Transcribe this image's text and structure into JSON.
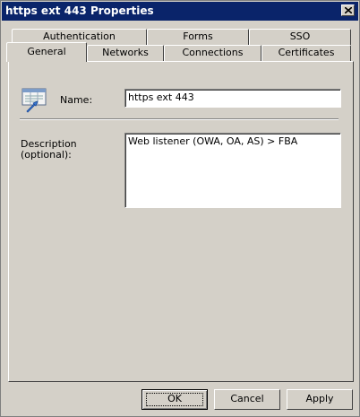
{
  "window": {
    "title": "https ext 443 Properties"
  },
  "tabs_back": [
    "Authentication",
    "Forms",
    "SSO"
  ],
  "tabs_front": [
    "General",
    "Networks",
    "Connections",
    "Certificates"
  ],
  "selected_tab": "General",
  "general": {
    "name_label": "Name:",
    "name_value": "https ext 443",
    "description_label_line1": "Description",
    "description_label_line2": "(optional):",
    "description_value": "Web listener (OWA, OA, AS) > FBA"
  },
  "buttons": {
    "ok": "OK",
    "cancel": "Cancel",
    "apply": "Apply"
  },
  "icons": {
    "listener": "web-listener-icon",
    "close": "close-icon"
  }
}
